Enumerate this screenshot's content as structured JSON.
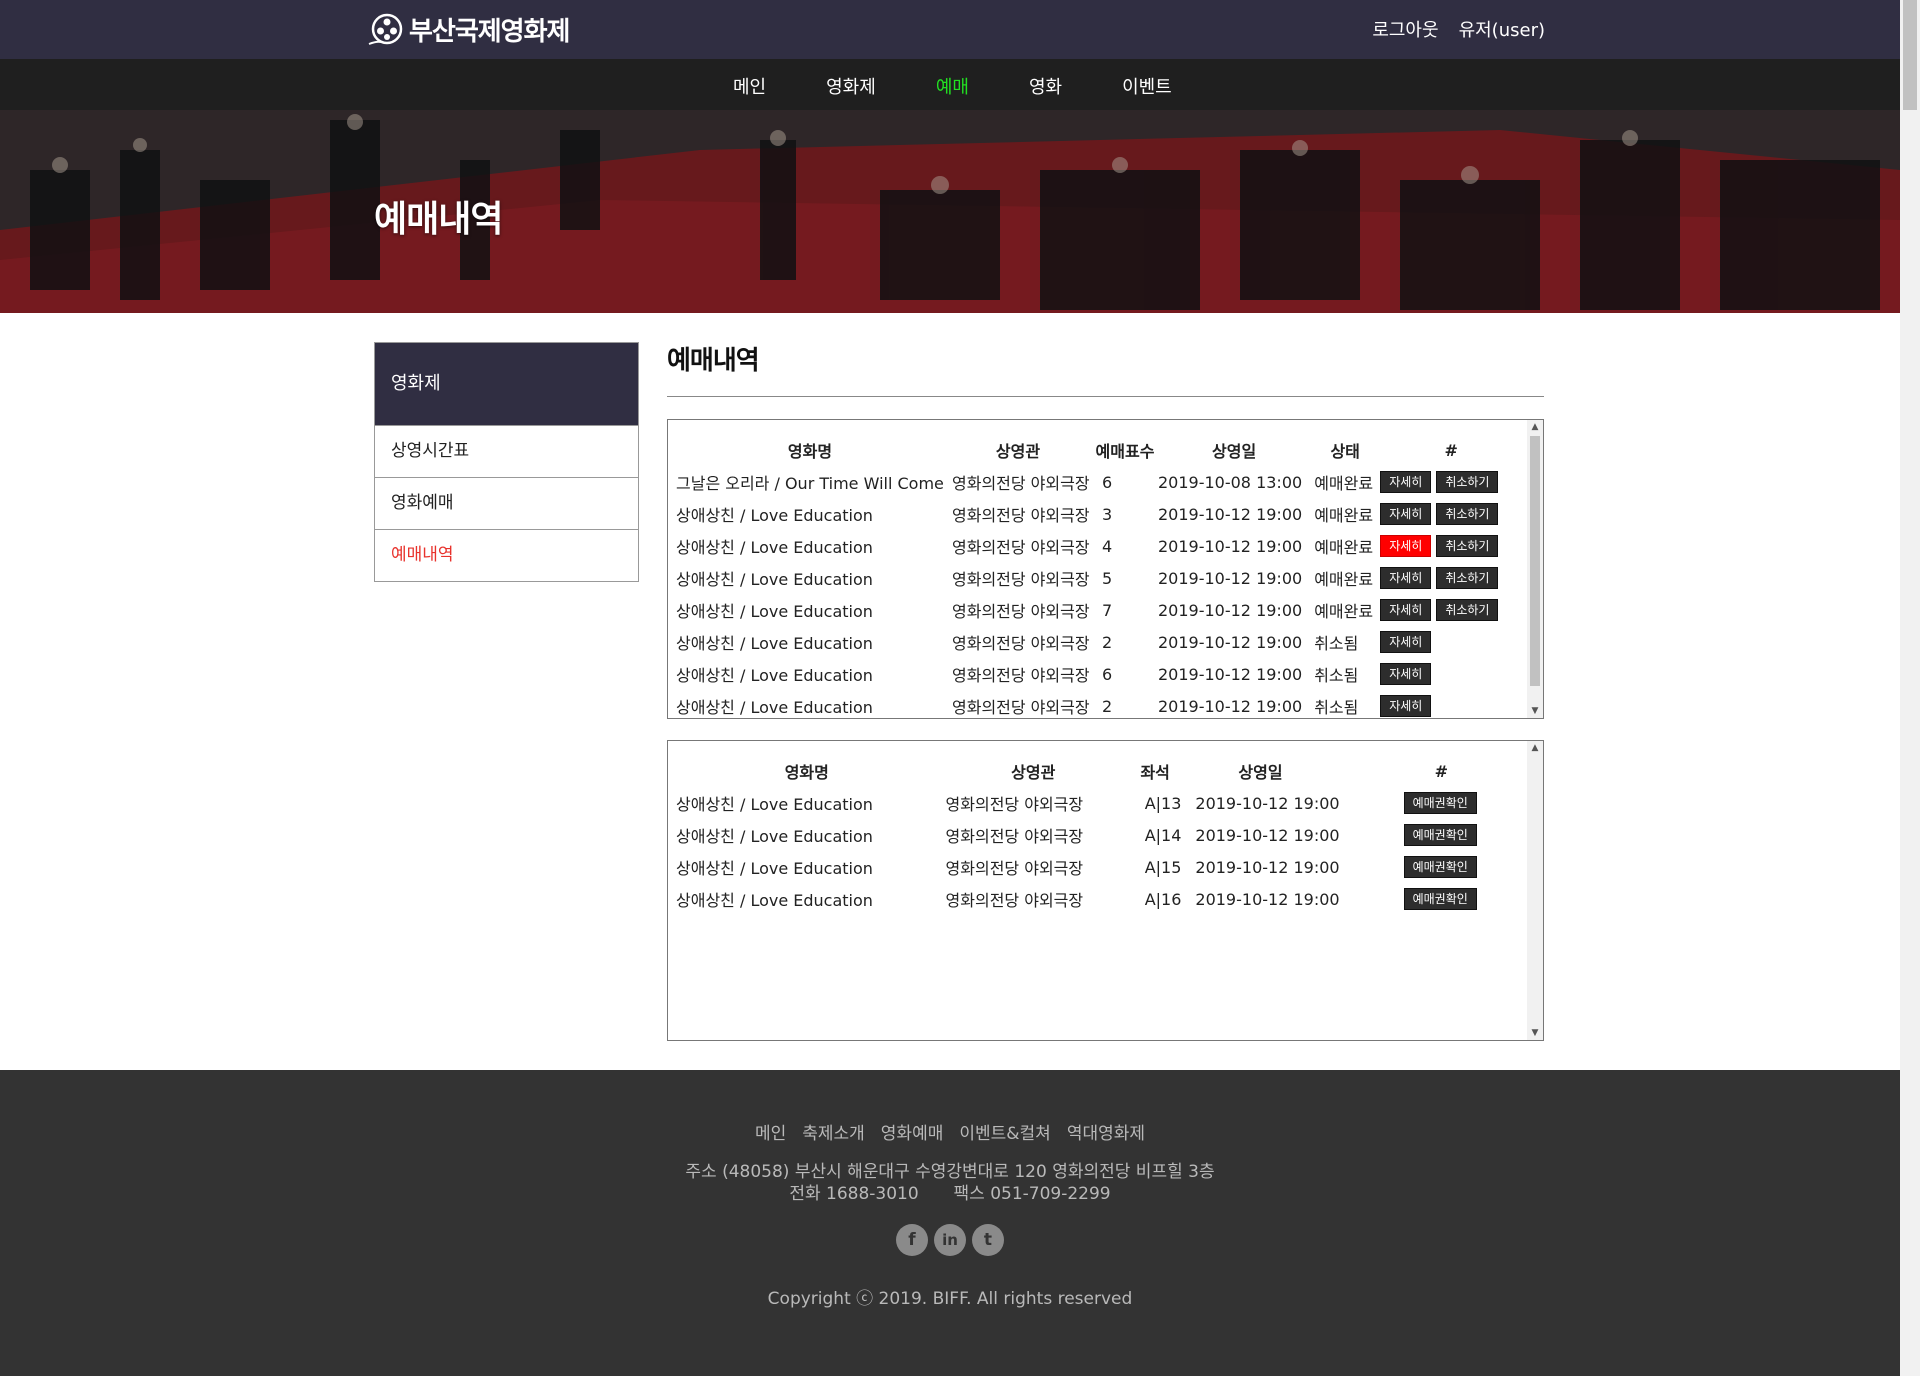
{
  "header": {
    "logo_text": "부산국제영화제",
    "links": [
      "로그아웃",
      "유저(user)"
    ]
  },
  "nav": {
    "items": [
      "메인",
      "영화제",
      "예매",
      "영화",
      "이벤트"
    ],
    "active_index": 2,
    "active_color": "#22e022"
  },
  "hero": {
    "title": "예매내역"
  },
  "sidebar": {
    "heading": "영화제",
    "items": [
      "상영시간표",
      "영화예매",
      "예매내역"
    ],
    "active_index": 2
  },
  "main": {
    "title": "예매내역"
  },
  "reservations": {
    "headers": [
      "영화명",
      "상영관",
      "예매표수",
      "상영일",
      "상태",
      "#"
    ],
    "rows": [
      {
        "movie": "그날은 오리라 / Our Time Will Come",
        "theater": "영화의전당 야외극장",
        "count": "6",
        "date": "2019-10-08 13:00",
        "status": "예매완료",
        "detail": "자세히",
        "cancel": "취소하기"
      },
      {
        "movie": "상애상친 / Love Education",
        "theater": "영화의전당 야외극장",
        "count": "3",
        "date": "2019-10-12 19:00",
        "status": "예매완료",
        "detail": "자세히",
        "cancel": "취소하기"
      },
      {
        "movie": "상애상친 / Love Education",
        "theater": "영화의전당 야외극장",
        "count": "4",
        "date": "2019-10-12 19:00",
        "status": "예매완료",
        "detail": "자세히",
        "cancel": "취소하기"
      },
      {
        "movie": "상애상친 / Love Education",
        "theater": "영화의전당 야외극장",
        "count": "5",
        "date": "2019-10-12 19:00",
        "status": "예매완료",
        "detail": "자세히",
        "cancel": "취소하기"
      },
      {
        "movie": "상애상친 / Love Education",
        "theater": "영화의전당 야외극장",
        "count": "7",
        "date": "2019-10-12 19:00",
        "status": "예매완료",
        "detail": "자세히",
        "cancel": "취소하기"
      },
      {
        "movie": "상애상친 / Love Education",
        "theater": "영화의전당 야외극장",
        "count": "2",
        "date": "2019-10-12 19:00",
        "status": "취소됨",
        "detail": "자세히",
        "cancel": ""
      },
      {
        "movie": "상애상친 / Love Education",
        "theater": "영화의전당 야외극장",
        "count": "6",
        "date": "2019-10-12 19:00",
        "status": "취소됨",
        "detail": "자세히",
        "cancel": ""
      },
      {
        "movie": "상애상친 / Love Education",
        "theater": "영화의전당 야외극장",
        "count": "2",
        "date": "2019-10-12 19:00",
        "status": "취소됨",
        "detail": "자세히",
        "cancel": ""
      }
    ],
    "selected_row": 2,
    "selected_color": "#ff0000"
  },
  "tickets": {
    "headers": [
      "영화명",
      "상영관",
      "좌석",
      "상영일",
      "#"
    ],
    "rows": [
      {
        "movie": "상애상친 / Love Education",
        "theater": "영화의전당 야외극장",
        "seat": "A|13",
        "date": "2019-10-12 19:00",
        "action": "예매권확인"
      },
      {
        "movie": "상애상친 / Love Education",
        "theater": "영화의전당 야외극장",
        "seat": "A|14",
        "date": "2019-10-12 19:00",
        "action": "예매권확인"
      },
      {
        "movie": "상애상친 / Love Education",
        "theater": "영화의전당 야외극장",
        "seat": "A|15",
        "date": "2019-10-12 19:00",
        "action": "예매권확인"
      },
      {
        "movie": "상애상친 / Love Education",
        "theater": "영화의전당 야외극장",
        "seat": "A|16",
        "date": "2019-10-12 19:00",
        "action": "예매권확인"
      }
    ]
  },
  "footer": {
    "links": [
      "메인",
      "축제소개",
      "영화예매",
      "이벤트&컬쳐",
      "역대영화제"
    ],
    "address": "주소 (48058) 부산시 해운대구 수영강변대로 120 영화의전당 비프힐 3층",
    "phone": "전화 1688-3010",
    "fax": "팩스 051-709-2299",
    "social": [
      {
        "icon": "facebook-icon",
        "glyph": "f"
      },
      {
        "icon": "linkedin-icon",
        "glyph": "in"
      },
      {
        "icon": "twitter-icon",
        "glyph": "t"
      }
    ],
    "copyright": "Copyright ⓒ 2019. BIFF. All rights reserved"
  }
}
